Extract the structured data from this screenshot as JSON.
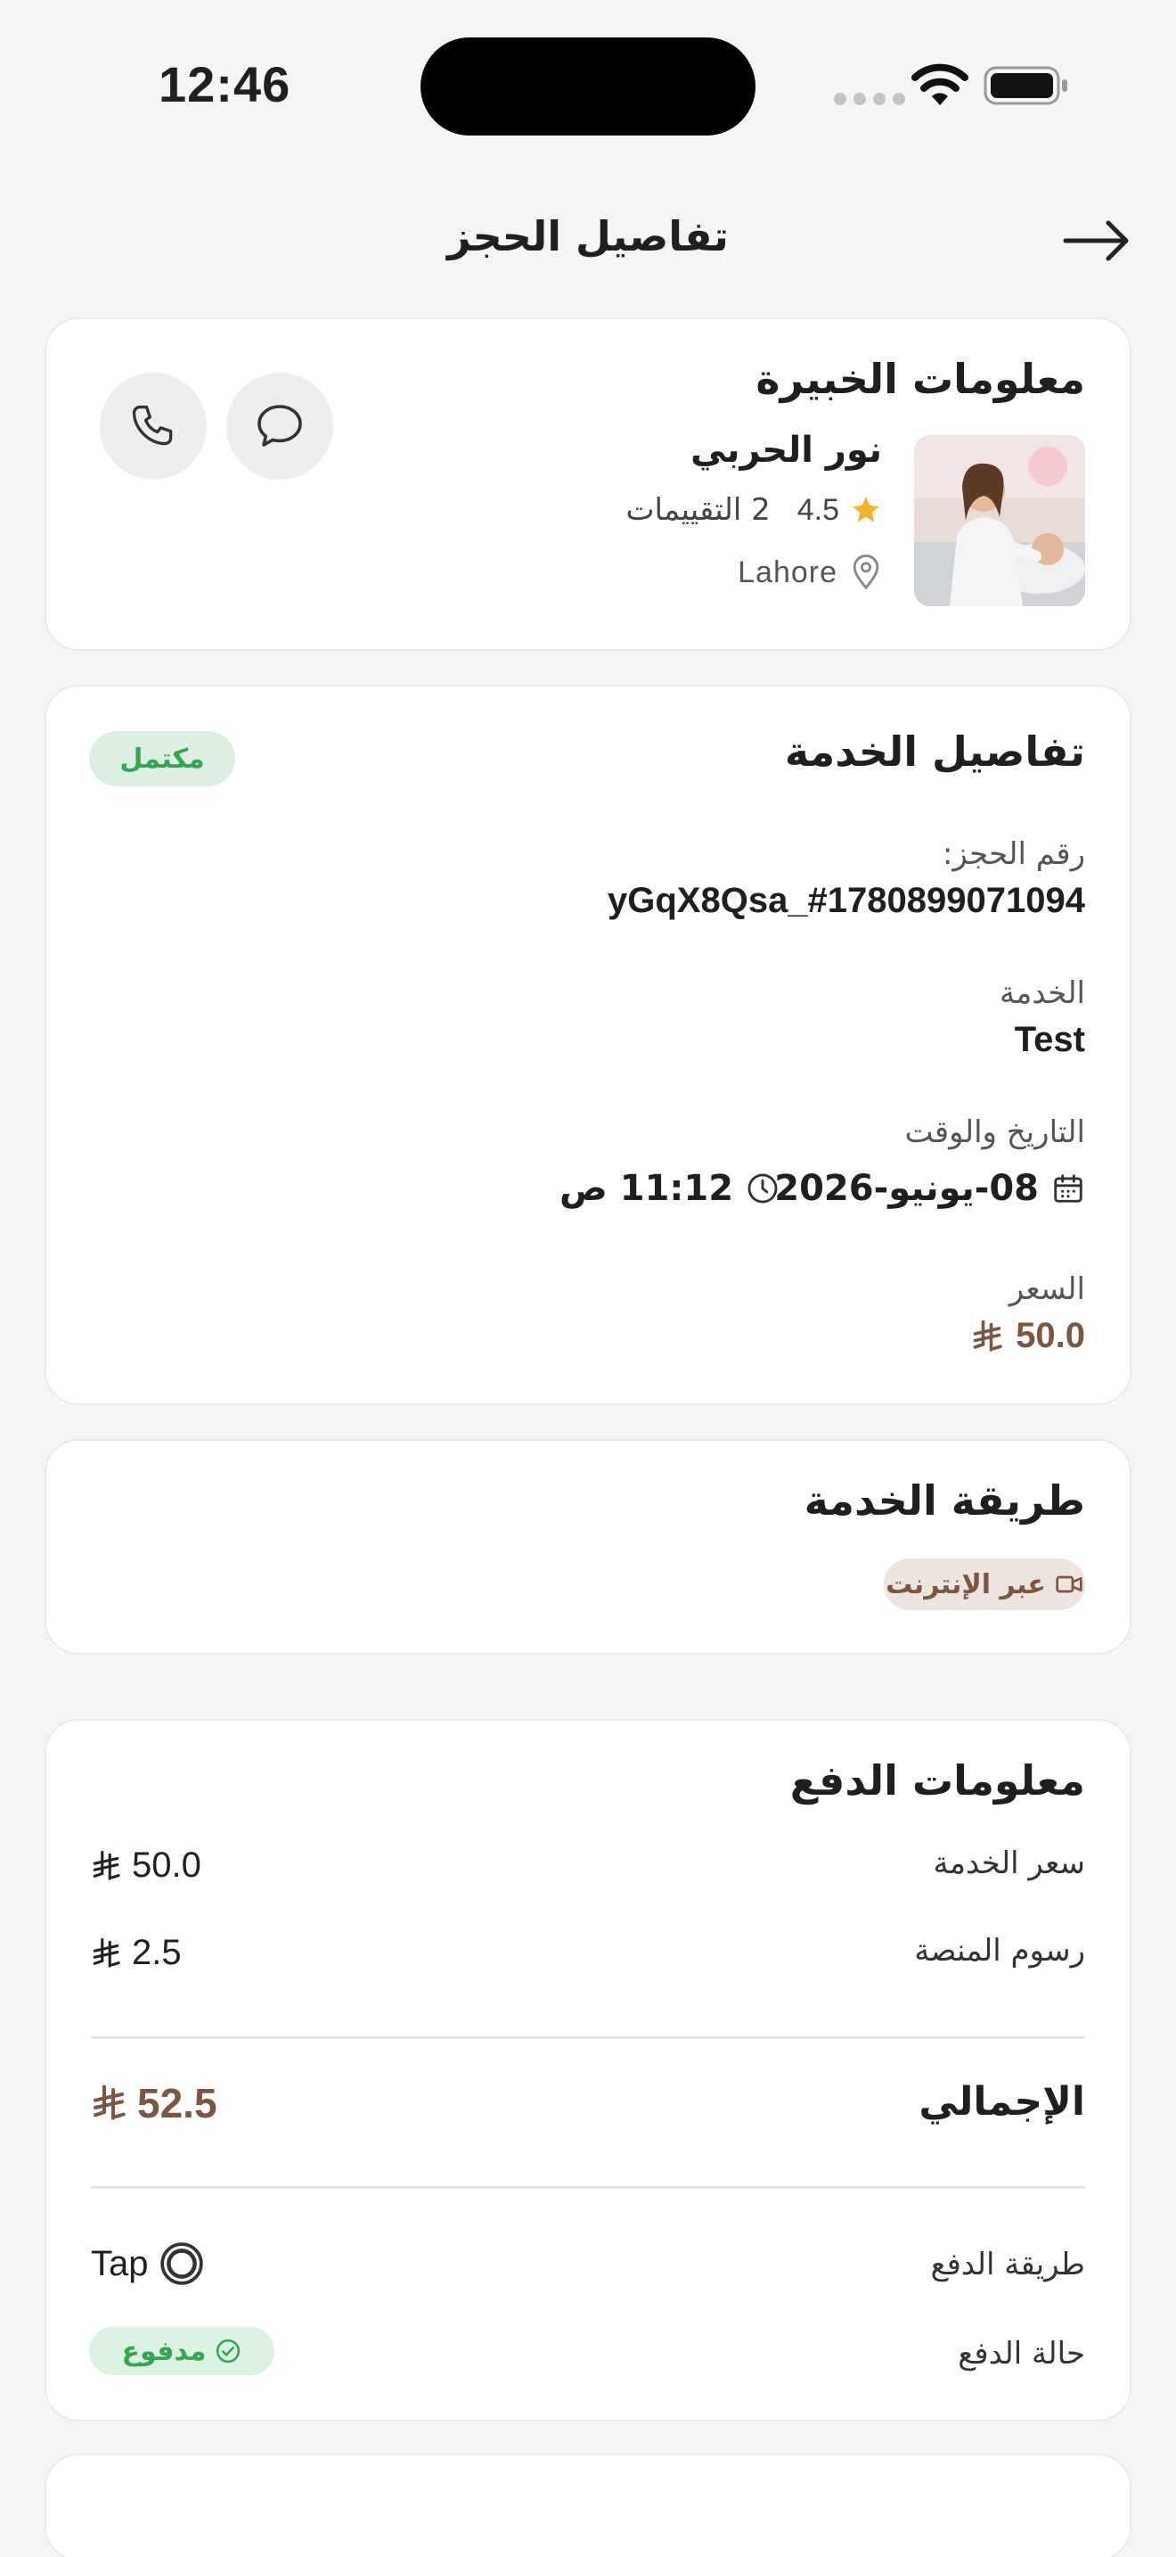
{
  "status_bar": {
    "time": "12:46"
  },
  "header": {
    "title": "تفاصيل الحجز"
  },
  "expert": {
    "section_title": "معلومات الخبيرة",
    "name": "نور الحربي",
    "rating": "4.5",
    "reviews": "2 التقييمات",
    "location": "Lahore"
  },
  "service": {
    "section_title": "تفاصيل الخدمة",
    "status_badge": "مكتمل",
    "booking_number_label": "رقم الحجز:",
    "booking_number": "yGqX8Qsa_#1780899071094",
    "service_label": "الخدمة",
    "service_name": "Test",
    "datetime_label": "التاريخ والوقت",
    "date": "08-يونيو-2026",
    "time": "11:12 ص",
    "price_label": "السعر",
    "price": "50.0"
  },
  "method": {
    "section_title": "طريقة الخدمة",
    "chip": "عبر الإنترنت"
  },
  "payment": {
    "section_title": "معلومات الدفع",
    "service_price_label": "سعر الخدمة",
    "service_price": "50.0",
    "platform_fee_label": "رسوم المنصة",
    "platform_fee": "2.5",
    "total_label": "الإجمالي",
    "total": "52.5",
    "method_label": "طريقة الدفع",
    "method_value": "Tap",
    "status_label": "حالة الدفع",
    "status_value": "مدفوع"
  },
  "colors": {
    "accent_brown": "#7a5643",
    "success_green": "#2fa84f",
    "star": "#f5b22a"
  }
}
